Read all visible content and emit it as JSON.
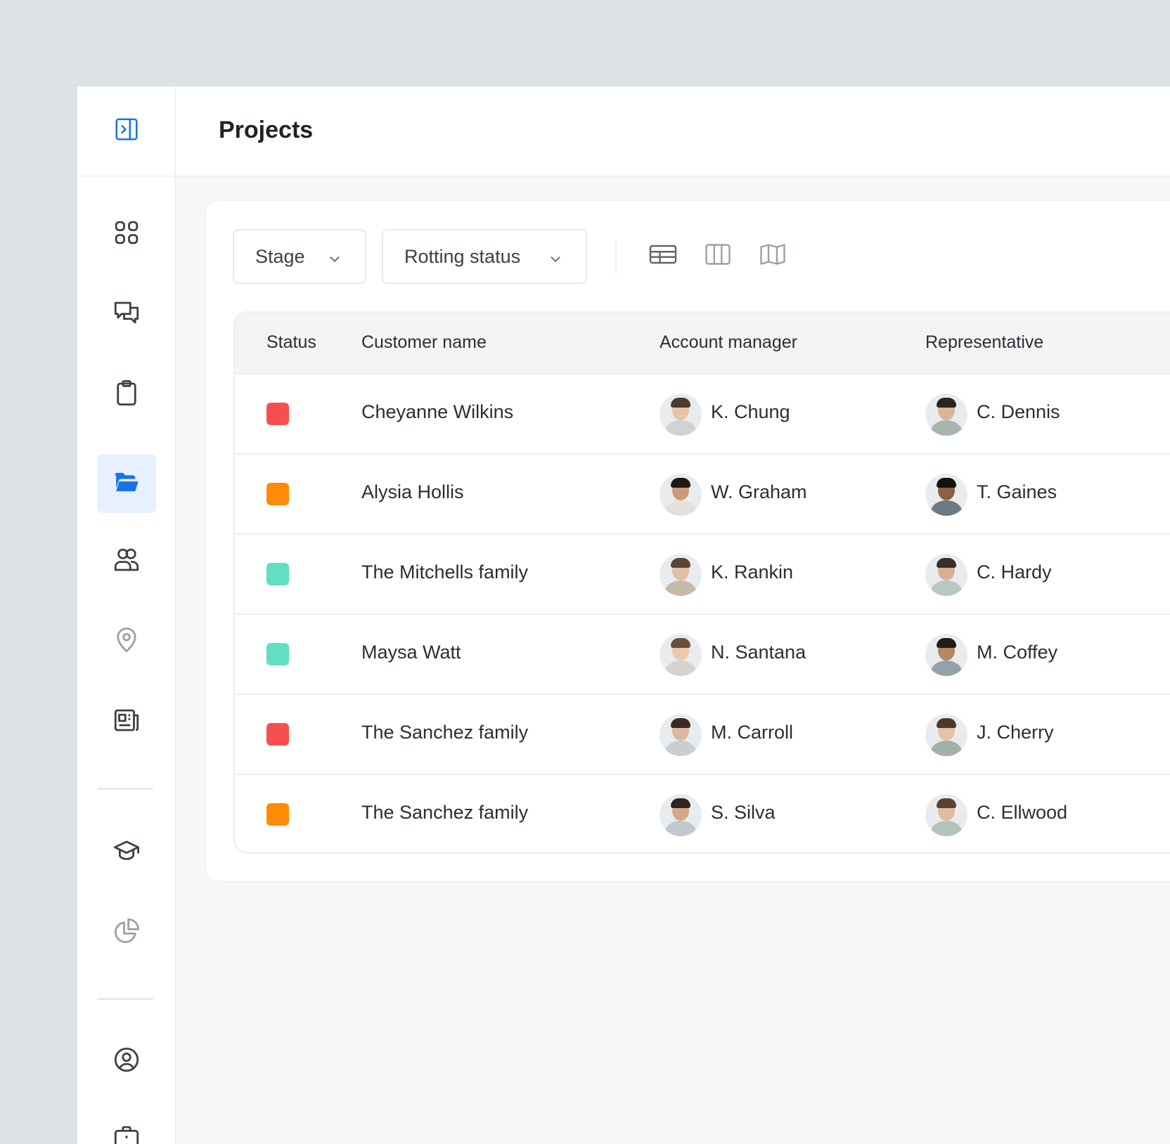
{
  "page": {
    "title": "Projects"
  },
  "sidebar": {
    "toggle_icon": "sidebar-expand-icon",
    "accent_color": "#1a73e8",
    "items": [
      {
        "name": "dashboard",
        "icon": "grid-icon",
        "active": false
      },
      {
        "name": "messages",
        "icon": "chat-bubbles-icon",
        "active": false
      },
      {
        "name": "tasks",
        "icon": "clipboard-icon",
        "active": false
      },
      {
        "name": "projects",
        "icon": "folder-open-icon",
        "active": true
      },
      {
        "name": "contacts",
        "icon": "users-icon",
        "active": false
      },
      {
        "name": "locations",
        "icon": "map-pin-icon",
        "active": false
      },
      {
        "name": "news",
        "icon": "newspaper-icon",
        "active": false
      },
      {
        "name": "learning",
        "icon": "graduation-cap-icon",
        "active": false
      },
      {
        "name": "reports",
        "icon": "pie-chart-icon",
        "active": false
      },
      {
        "name": "profile",
        "icon": "user-circle-icon",
        "active": false
      },
      {
        "name": "briefcase",
        "icon": "briefcase-icon",
        "active": false
      }
    ]
  },
  "filters": {
    "stage_label": "Stage",
    "rotting_label": "Rotting status"
  },
  "view_buttons": [
    "table-view-icon",
    "columns-view-icon",
    "map-view-icon"
  ],
  "table": {
    "headers": {
      "status": "Status",
      "customer": "Customer name",
      "manager": "Account manager",
      "rep": "Representative"
    },
    "status_colors": {
      "red": "#f74f50",
      "orange": "#ff8a05",
      "teal": "#60dfc4"
    },
    "rows": [
      {
        "status": "red",
        "customer": "Cheyanne Wilkins",
        "manager": "K. Chung",
        "rep": "C. Dennis"
      },
      {
        "status": "orange",
        "customer": "Alysia Hollis",
        "manager": "W. Graham",
        "rep": "T. Gaines"
      },
      {
        "status": "teal",
        "customer": "The Mitchells family",
        "manager": "K. Rankin",
        "rep": "C. Hardy"
      },
      {
        "status": "teal",
        "customer": "Maysa Watt",
        "manager": "N. Santana",
        "rep": "M. Coffey"
      },
      {
        "status": "red",
        "customer": "The Sanchez family",
        "manager": "M. Carroll",
        "rep": "J. Cherry"
      },
      {
        "status": "orange",
        "customer": "The Sanchez family",
        "manager": "S. Silva",
        "rep": "C. Ellwood"
      }
    ]
  }
}
